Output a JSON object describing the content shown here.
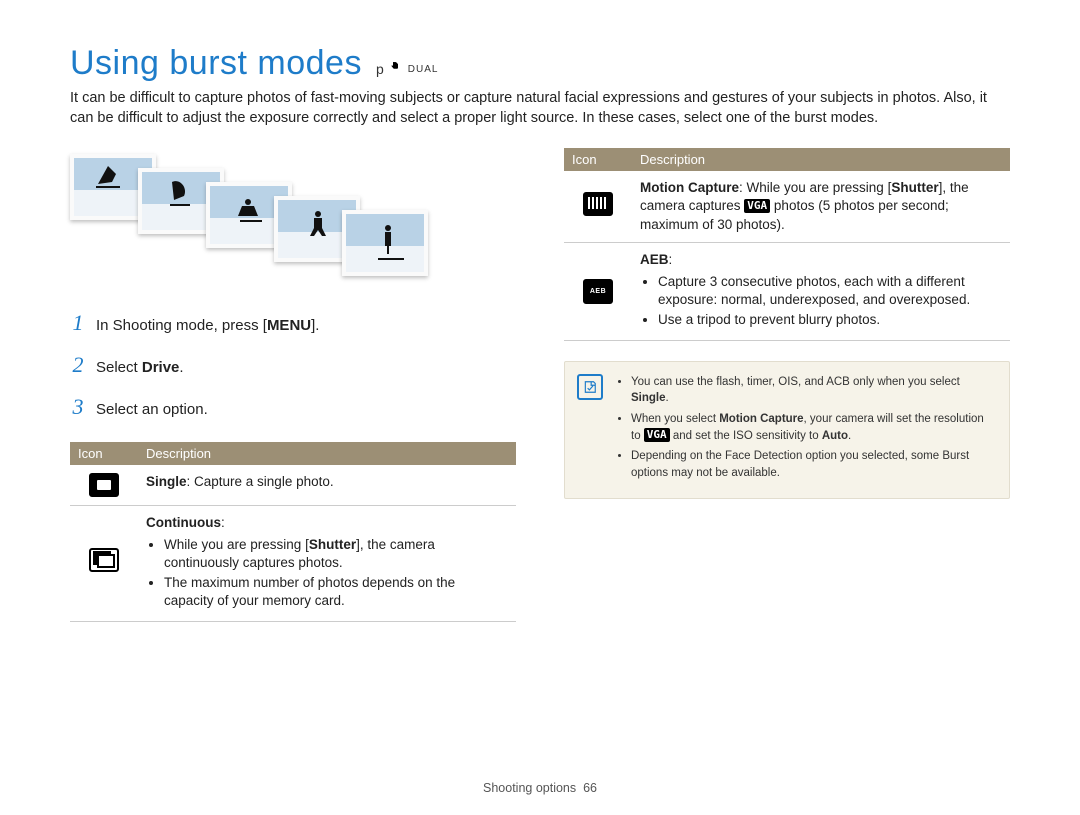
{
  "title": "Using burst modes",
  "mode_p": "p",
  "mode_dual": "DUAL",
  "intro": "It can be difficult to capture photos of fast-moving subjects or capture natural facial expressions and gestures of your subjects in photos. Also, it can be difficult to adjust the exposure correctly and select a proper light source. In these cases, select one of the burst modes.",
  "steps": [
    {
      "pre": "In Shooting mode, press [",
      "bold": "MENU",
      "post": "]."
    },
    {
      "pre": "Select ",
      "bold": "Drive",
      "post": "."
    },
    {
      "pre": "Select an option.",
      "bold": "",
      "post": ""
    }
  ],
  "table_head": {
    "icon": "Icon",
    "desc": "Description"
  },
  "left_rows": {
    "single": {
      "bold": "Single",
      "rest": ": Capture a single photo."
    },
    "continuous": {
      "title": "Continuous",
      "b1_pre": "While you are pressing [",
      "b1_bold": "Shutter",
      "b1_post": "], the camera continuously captures photos.",
      "b2": "The maximum number of photos depends on the capacity of your memory card."
    }
  },
  "right_rows": {
    "motion": {
      "bold": "Motion Capture",
      "mid1": ": While you are pressing [",
      "bold2": "Shutter",
      "mid2": "], the camera captures ",
      "vga": "VGA",
      "tail": " photos (5 photos per second; maximum of 30 photos)."
    },
    "aeb": {
      "title": "AEB",
      "b1": "Capture 3 consecutive photos, each with a different exposure: normal, underexposed, and overexposed.",
      "b2": "Use a tripod to prevent blurry photos."
    }
  },
  "notes": {
    "n1_pre": "You can use the flash, timer, OIS, and ACB only when you select ",
    "n1_bold": "Single",
    "n1_post": ".",
    "n2_pre": "When you select ",
    "n2_bold1": "Motion Capture",
    "n2_mid": ", your camera will set the resolution to ",
    "n2_vga": "VGA",
    "n2_mid2": " and set the ISO sensitivity to ",
    "n2_bold2": "Auto",
    "n2_post": ".",
    "n3": "Depending on the Face Detection option you selected, some Burst options may not be available."
  },
  "footer": {
    "section": "Shooting options",
    "page": "66"
  }
}
